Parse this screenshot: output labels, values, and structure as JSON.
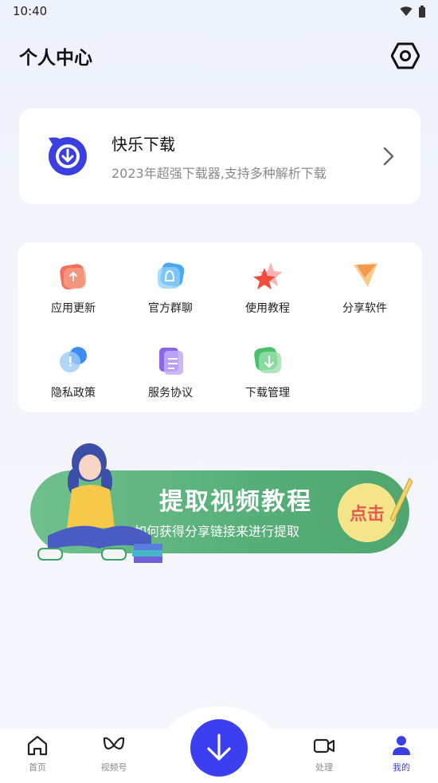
{
  "status_bar": {
    "time": "10:40",
    "wifi_icon": "wifi-icon",
    "battery_icon": "battery-icon"
  },
  "header": {
    "title": "个人中心",
    "settings_icon": "settings-hex-icon"
  },
  "app_card": {
    "name": "快乐下载",
    "description": "2023年超强下载器,支持多种解析下载"
  },
  "menu": {
    "items": [
      {
        "label": "应用更新",
        "icon": "update-icon",
        "color": "#f0705a"
      },
      {
        "label": "官方群聊",
        "icon": "group-chat-icon",
        "color": "#4aa8f2"
      },
      {
        "label": "使用教程",
        "icon": "star-icon",
        "color": "#f04b3c"
      },
      {
        "label": "分享软件",
        "icon": "share-icon",
        "color": "#f29a4a"
      },
      {
        "label": "隐私政策",
        "icon": "privacy-icon",
        "color": "#3d8ef0"
      },
      {
        "label": "服务协议",
        "icon": "document-icon",
        "color": "#8a66e8"
      },
      {
        "label": "下载管理",
        "icon": "download-manage-icon",
        "color": "#49c06a"
      }
    ]
  },
  "banner": {
    "title": "提取视频教程",
    "subtitle": "如何获得分享链接来进行提取",
    "button": "点击"
  },
  "bottom_nav": {
    "items": [
      {
        "label": "首页",
        "icon": "home-icon"
      },
      {
        "label": "视频号",
        "icon": "video-channel-icon"
      },
      {
        "label": "处理",
        "icon": "video-camera-icon"
      },
      {
        "label": "我的",
        "icon": "user-icon"
      }
    ],
    "active": "我的",
    "center_icon": "download-arrow-icon"
  },
  "colors": {
    "accent": "#3b3ff0",
    "banner": "#5fb37f"
  }
}
